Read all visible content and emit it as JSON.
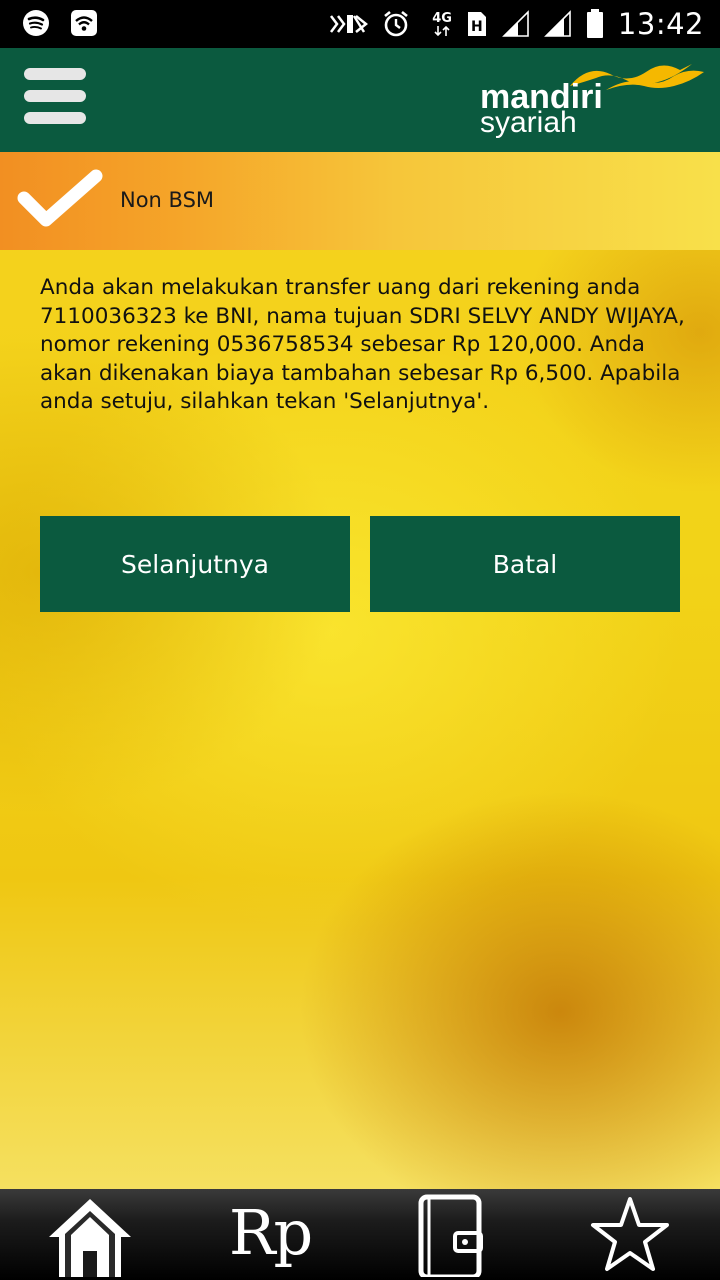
{
  "status_bar": {
    "network_type": "4G",
    "time": "13:42",
    "left_icons": [
      "spotify-icon",
      "wifi-hotspot-icon"
    ],
    "right_icons": [
      "nfc-icon",
      "alarm-icon",
      "network-4g-icon",
      "sim-icon",
      "signal-icon",
      "signal-icon",
      "battery-icon"
    ]
  },
  "app_bar": {
    "menu_icon": "hamburger-menu-icon",
    "logo": {
      "line1": "mandiri",
      "line2": "syariah"
    }
  },
  "header": {
    "check_icon": "check-icon",
    "title": "Non BSM"
  },
  "message": "Anda akan melakukan transfer uang dari rekening anda 7110036323 ke BNI, nama tujuan SDRI SELVY ANDY WIJAYA, nomor rekening 0536758534 sebesar Rp 120,000. Anda akan dikenakan biaya tambahan sebesar Rp 6,500. Apabila anda setuju, silahkan tekan 'Selanjutnya'.",
  "buttons": {
    "next_label": "Selanjutnya",
    "cancel_label": "Batal"
  },
  "bottom_nav": {
    "items": [
      {
        "icon": "home-icon"
      },
      {
        "icon": "rupiah-icon",
        "label": "Rp"
      },
      {
        "icon": "book-icon"
      },
      {
        "icon": "star-icon"
      }
    ]
  },
  "colors": {
    "primary_green": "#0b5a3f",
    "header_orange": "#f28f22",
    "header_yellow": "#f8e04a",
    "logo_wave_yellow": "#f5b800"
  }
}
